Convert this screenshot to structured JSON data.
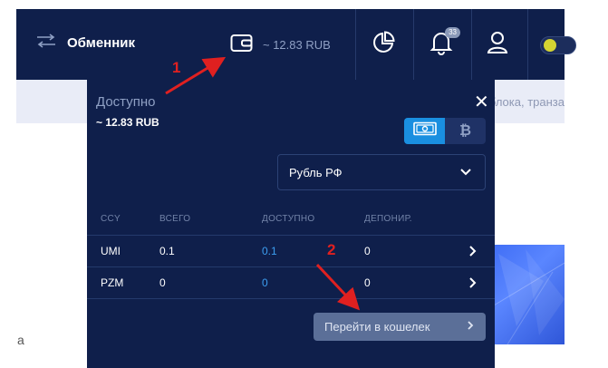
{
  "topbar": {
    "exchange_label": "Обменник",
    "wallet_balance": "~ 12.83 RUB",
    "notifications_count": "33"
  },
  "search": {
    "hint": "блока, транза"
  },
  "background": {
    "left_letter": "а"
  },
  "panel": {
    "title": "Доступно",
    "total": "~ 12.83 RUB",
    "currency_toggle": [
      "fiat-icon",
      "bitcoin-icon"
    ],
    "currency_select": "Рубль РФ",
    "columns": [
      "CCY",
      "ВСЕГО",
      "ДОСТУПНО",
      "ДЕПОНИР."
    ],
    "rows": [
      {
        "ccy": "UMI",
        "total": "0.1",
        "available": "0.1",
        "deposited": "0"
      },
      {
        "ccy": "PZM",
        "total": "0",
        "available": "0",
        "deposited": "0"
      }
    ],
    "go_wallet_label": "Перейти в кошелек"
  },
  "annotations": {
    "step1": "1",
    "step2": "2"
  },
  "colors": {
    "nav_bg": "#0f1f4b",
    "accent_blue": "#1a8fe0",
    "available_blue": "#3c9ef0",
    "annotation_red": "#e02020"
  }
}
